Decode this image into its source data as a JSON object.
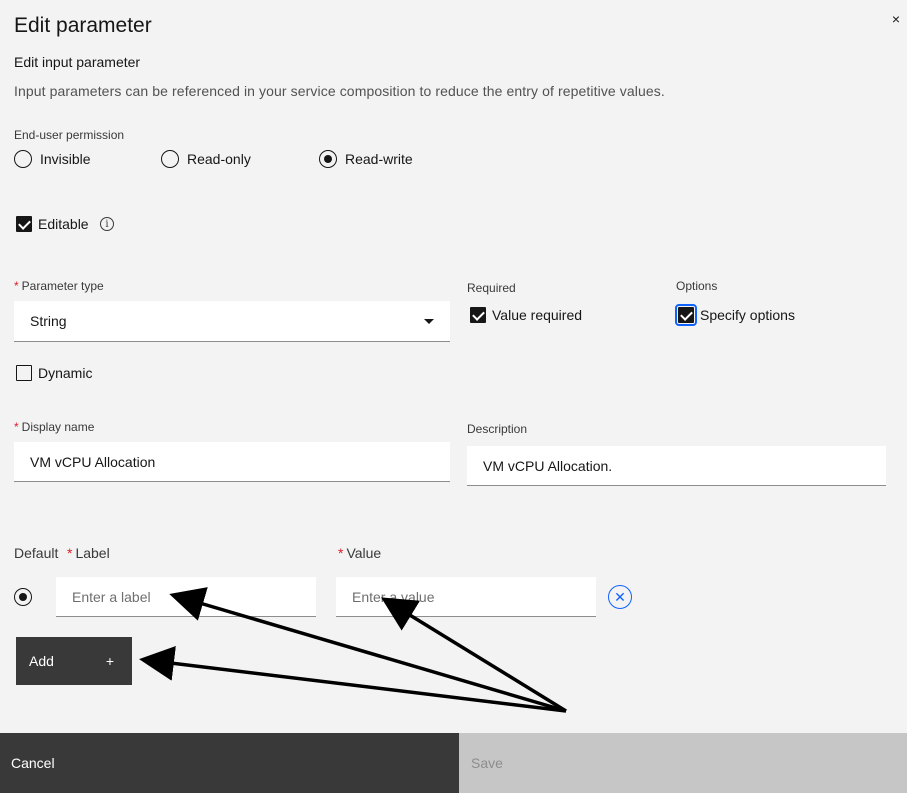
{
  "modal": {
    "title": "Edit parameter",
    "subtitle": "Edit input parameter",
    "helper_text": "Input parameters can be referenced in your service composition to reduce the entry of repetitive values.",
    "close_symbol": "×"
  },
  "permission": {
    "label": "End-user permission",
    "options": [
      "Invisible",
      "Read-only",
      "Read-write"
    ],
    "selected": "Read-write"
  },
  "editable": {
    "label": "Editable",
    "checked": true,
    "info_symbol": "i"
  },
  "parameter_type": {
    "label": "Parameter type",
    "value": "String"
  },
  "required": {
    "label": "Required",
    "checkbox_label": "Value required",
    "checked": true
  },
  "options": {
    "label": "Options",
    "checkbox_label": "Specify options",
    "checked": true
  },
  "dynamic": {
    "label": "Dynamic",
    "checked": false
  },
  "display_name": {
    "label": "Display name",
    "value": "VM vCPU Allocation"
  },
  "description": {
    "label": "Description",
    "value": "VM vCPU Allocation."
  },
  "option_rows": {
    "default_label": "Default",
    "label_header": "Label",
    "value_header": "Value",
    "label_placeholder": "Enter a label",
    "value_placeholder": "Enter a value",
    "remove_symbol": "✕"
  },
  "add_button": {
    "label": "Add",
    "icon": "+"
  },
  "footer": {
    "cancel_label": "Cancel",
    "save_label": "Save"
  },
  "colors": {
    "background": "#f3f3f3",
    "primary_dark": "#393939",
    "focus_blue": "#0f62fe",
    "required_red": "#da1e28",
    "disabled": "#c6c6c6",
    "annotation_arrow": "#000000"
  }
}
